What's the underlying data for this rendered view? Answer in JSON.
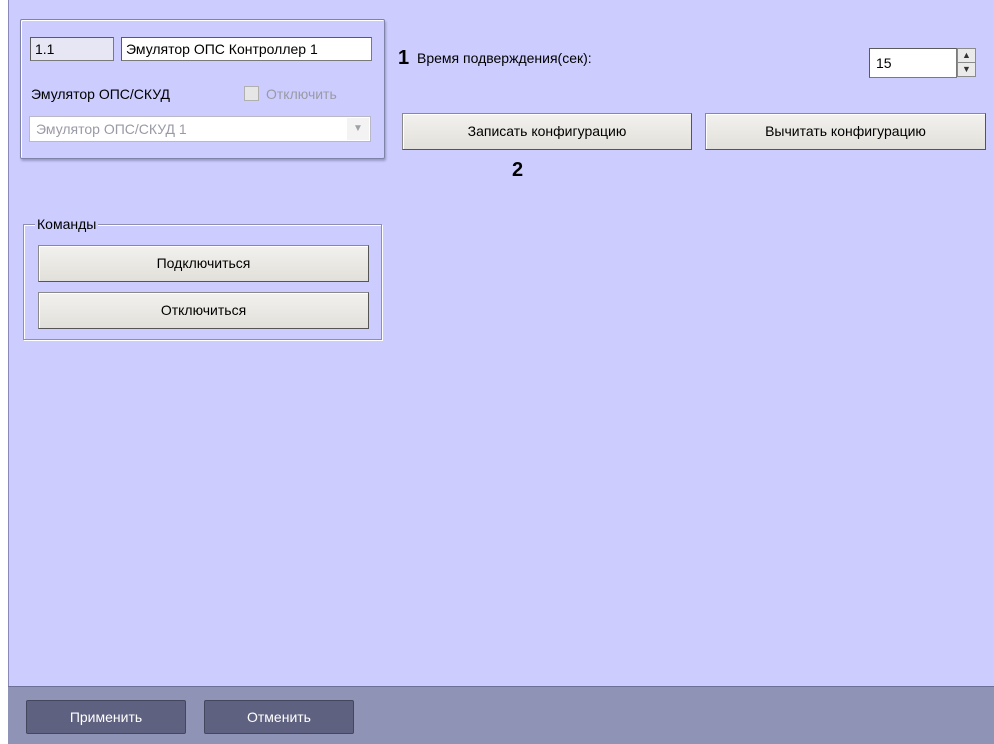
{
  "object_panel": {
    "id_value": "1.1",
    "name_value": "Эмулятор ОПС Контроллер 1",
    "type_label": "Эмулятор ОПС/СКУД",
    "disable_label": "Отключить",
    "disable_checked": false,
    "parent_value": "Эмулятор ОПС/СКУД 1"
  },
  "settings": {
    "marker_1": "1",
    "confirm_time_label": "Время подверждения(сек):",
    "confirm_time_value": "15",
    "write_config_label": "Записать конфигурацию",
    "read_config_label": "Вычитать конфигурацию",
    "marker_2": "2"
  },
  "commands": {
    "group_title": "Команды",
    "connect_label": "Подключиться",
    "disconnect_label": "Отключиться"
  },
  "footer": {
    "apply_label": "Применить",
    "cancel_label": "Отменить"
  },
  "colors": {
    "panel_bg": "#ccccfe",
    "footer_bg": "#8f93b6",
    "footer_button_bg": "#5f6180"
  }
}
